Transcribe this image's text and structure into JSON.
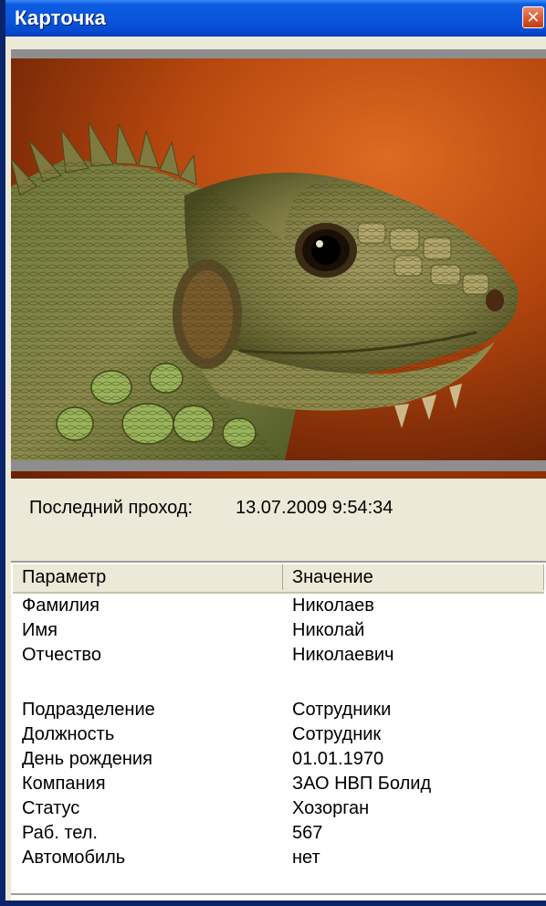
{
  "window": {
    "title": "Карточка"
  },
  "photo": {
    "subject": "iguana"
  },
  "last_pass": {
    "label": "Последний проход:",
    "value": "13.07.2009 9:54:34"
  },
  "grid": {
    "columns": [
      "Параметр",
      "Значение"
    ],
    "rows": [
      {
        "param": "Фамилия",
        "value": "Николаев"
      },
      {
        "param": "Имя",
        "value": "Николай"
      },
      {
        "param": "Отчество",
        "value": "Николаевич"
      },
      {
        "param": "",
        "value": ""
      },
      {
        "param": "Подразделение",
        "value": "Сотрудники"
      },
      {
        "param": "Должность",
        "value": "Сотрудник"
      },
      {
        "param": "День рождения",
        "value": "01.01.1970"
      },
      {
        "param": "Компания",
        "value": "ЗАО НВП Болид"
      },
      {
        "param": "Статус",
        "value": "Хозорган"
      },
      {
        "param": "Раб. тел.",
        "value": "567"
      },
      {
        "param": "Автомобиль",
        "value": "нет"
      }
    ]
  },
  "colors": {
    "titlebar": "#0a56de",
    "window_bg": "#ece9d8",
    "close": "#d9532d"
  },
  "icons": {
    "close": "close-icon"
  }
}
